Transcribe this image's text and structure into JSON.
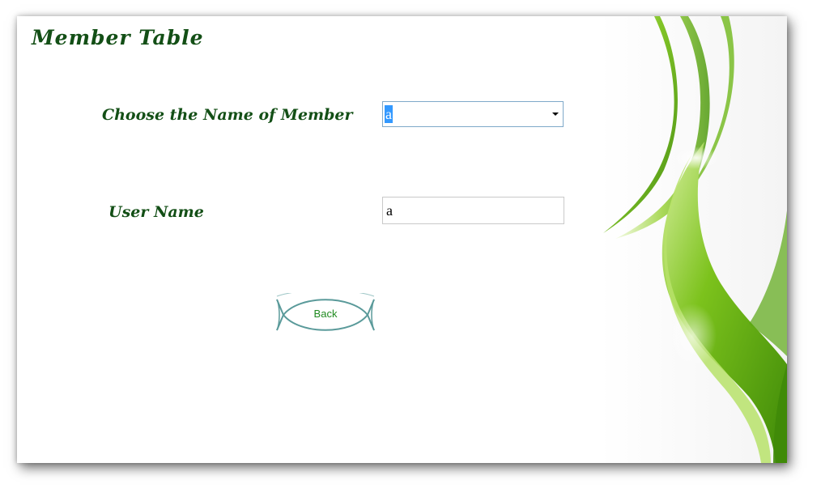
{
  "window": {
    "title": "Member Table"
  },
  "form": {
    "member_label": "Choose the Name of Member",
    "member_selected": "a",
    "username_label": "User Name",
    "username_value": "a"
  },
  "actions": {
    "back_label": "Back"
  },
  "colors": {
    "label_text": "#134f16",
    "button_text": "#1f8a1f",
    "button_outline": "#5a9a9a",
    "selection_highlight": "#3399ff",
    "swirl_green": "#7cc21c"
  },
  "icons": {
    "dropdown": "chevron-down-icon",
    "decoration": "green-swirl-decoration"
  }
}
